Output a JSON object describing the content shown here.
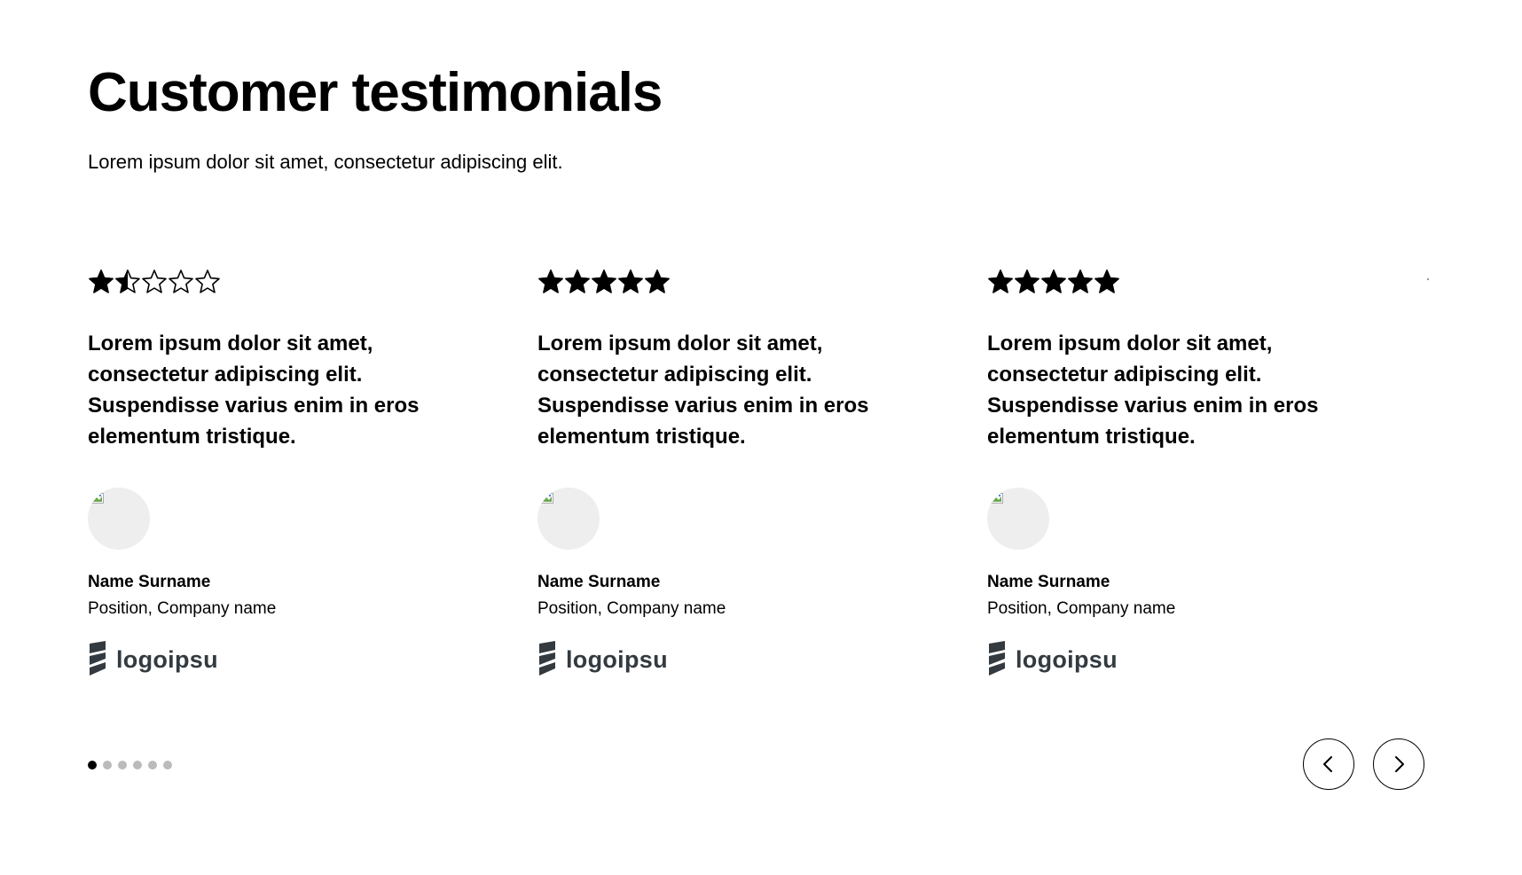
{
  "section": {
    "title": "Customer testimonials",
    "subtitle": "Lorem ipsum dolor sit amet, consectetur adipiscing elit."
  },
  "testimonials": [
    {
      "rating": 1.5,
      "quote": "Lorem ipsum dolor sit amet, consectetur adipiscing elit. Suspendisse varius enim in eros elementum tristique.",
      "name": "Name Surname",
      "role": "Position, Company name",
      "logo_text": "logoipsu"
    },
    {
      "rating": 5,
      "quote": "Lorem ipsum dolor sit amet, consectetur adipiscing elit. Suspendisse varius enim in eros elementum tristique.",
      "name": "Name Surname",
      "role": "Position, Company name",
      "logo_text": "logoipsu"
    },
    {
      "rating": 5,
      "quote": "Lorem ipsum dolor sit amet, consectetur adipiscing elit. Suspendisse varius enim in eros elementum tristique.",
      "name": "Name Surname",
      "role": "Position, Company name",
      "logo_text": "logoipsu"
    }
  ],
  "pagination": {
    "total": 6,
    "active_index": 0
  },
  "icons": {
    "star": "star-icon",
    "prev": "chevron-left-icon",
    "next": "chevron-right-icon",
    "logo": "logo-mark-icon",
    "avatar": "broken-image-icon"
  },
  "colors": {
    "text": "#000000",
    "logo": "#333a40",
    "avatar_bg": "#eeeeee",
    "dot_inactive": "#bbbbbb",
    "dot_active": "#000000"
  }
}
